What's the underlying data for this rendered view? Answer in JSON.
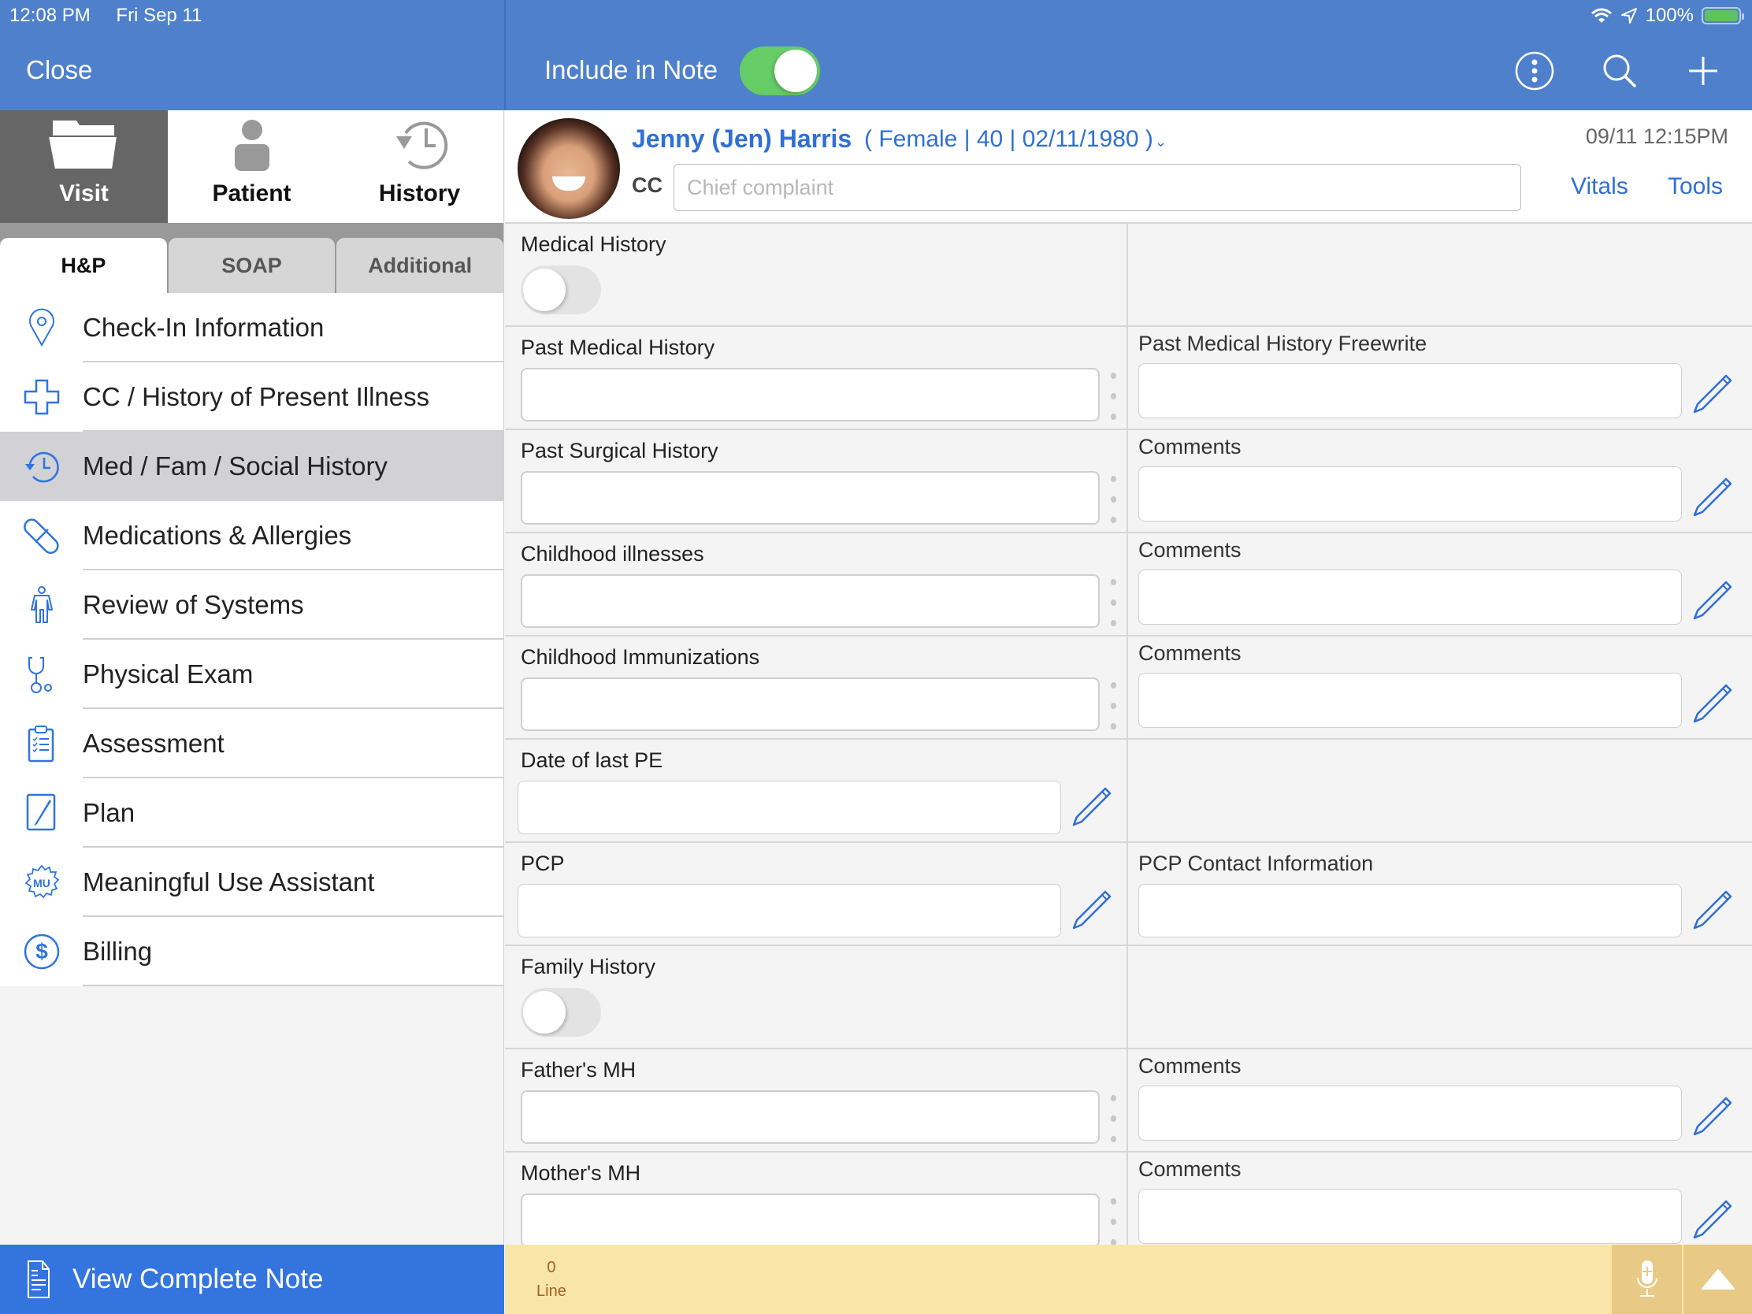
{
  "status_bar": {
    "time": "12:08 PM",
    "date": "Fri Sep 11",
    "battery": "100%"
  },
  "header": {
    "close_label": "Close",
    "include_in_note_label": "Include in Note",
    "include_in_note_on": true,
    "icons": [
      "more-icon",
      "search-icon",
      "add-icon"
    ]
  },
  "left_panel": {
    "main_tabs": [
      {
        "label": "Visit",
        "icon": "folder-icon",
        "active": true
      },
      {
        "label": "Patient",
        "icon": "person-icon",
        "active": false
      },
      {
        "label": "History",
        "icon": "history-icon",
        "active": false
      }
    ],
    "sub_tabs": [
      {
        "label": "H&P",
        "active": true
      },
      {
        "label": "SOAP",
        "active": false
      },
      {
        "label": "Additional",
        "active": false
      }
    ],
    "menu_items": [
      {
        "label": "Check-In Information",
        "icon": "location-pin-icon"
      },
      {
        "label": "CC / History of Present Illness",
        "icon": "medical-cross-icon"
      },
      {
        "label": "Med / Fam / Social History",
        "icon": "history-icon",
        "active": true
      },
      {
        "label": "Medications & Allergies",
        "icon": "pill-icon"
      },
      {
        "label": "Review of Systems",
        "icon": "body-icon"
      },
      {
        "label": "Physical Exam",
        "icon": "stethoscope-icon"
      },
      {
        "label": "Assessment",
        "icon": "clipboard-checklist-icon"
      },
      {
        "label": "Plan",
        "icon": "pen-document-icon"
      },
      {
        "label": "Meaningful Use Assistant",
        "icon": "mu-badge-icon"
      },
      {
        "label": "Billing",
        "icon": "dollar-circle-icon"
      }
    ],
    "view_note_label": "View Complete Note"
  },
  "patient": {
    "name": "Jenny (Jen) Harris",
    "info": "( Female | 40 | 02/11/1980 )",
    "cc_label": "CC",
    "cc_placeholder": "Chief complaint",
    "cc_value": "",
    "visit_time": "09/11 12:15PM",
    "vitals_label": "Vitals",
    "tools_label": "Tools"
  },
  "form": {
    "rows": [
      {
        "left": {
          "label": "Medical History",
          "type": "toggle",
          "on": false
        },
        "right": null
      },
      {
        "left": {
          "label": "Past Medical History",
          "type": "field",
          "value": ""
        },
        "right": {
          "label": "Past Medical History Freewrite",
          "value": ""
        }
      },
      {
        "left": {
          "label": "Past Surgical History",
          "type": "field",
          "value": ""
        },
        "right": {
          "label": "Comments",
          "value": ""
        }
      },
      {
        "left": {
          "label": "Childhood illnesses",
          "type": "field",
          "value": ""
        },
        "right": {
          "label": "Comments",
          "value": ""
        }
      },
      {
        "left": {
          "label": "Childhood Immunizations",
          "type": "field",
          "value": ""
        },
        "right": {
          "label": "Comments",
          "value": ""
        }
      },
      {
        "left": {
          "label": "Date of last PE",
          "type": "short",
          "value": ""
        },
        "right": null
      },
      {
        "left": {
          "label": "PCP",
          "type": "short",
          "value": ""
        },
        "right": {
          "label": "PCP Contact Information",
          "value": ""
        }
      },
      {
        "left": {
          "label": "Family History",
          "type": "toggle",
          "on": false
        },
        "right": null
      },
      {
        "left": {
          "label": "Father's MH",
          "type": "field",
          "value": ""
        },
        "right": {
          "label": "Comments",
          "value": ""
        }
      },
      {
        "left": {
          "label": "Mother's MH",
          "type": "field",
          "value": ""
        },
        "right": {
          "label": "Comments",
          "value": ""
        }
      }
    ]
  },
  "footer": {
    "line_count": "0",
    "line_label": "Line"
  },
  "colors": {
    "header_blue": "#4f80cc",
    "accent_blue": "#2f6fd6",
    "toggle_green": "#66cc66",
    "bottom_blue": "#3474de",
    "footer_yellow": "#f9e5a7"
  }
}
